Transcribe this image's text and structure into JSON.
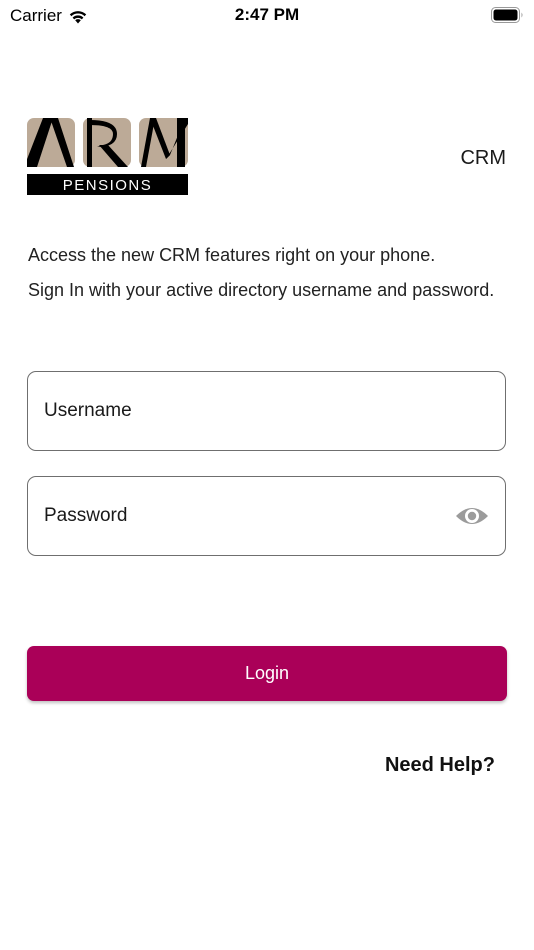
{
  "status_bar": {
    "carrier": "Carrier",
    "time": "2:47 PM"
  },
  "header": {
    "logo_letters": "ARM",
    "logo_subtitle": "PENSIONS",
    "title": "CRM"
  },
  "intro": {
    "line1": "Access the new CRM features right on your phone.",
    "line2": "Sign In with your active directory username and password."
  },
  "form": {
    "username_placeholder": "Username",
    "password_placeholder": "Password",
    "login_label": "Login"
  },
  "help": {
    "label": "Need Help?"
  },
  "colors": {
    "accent": "#aa0058",
    "logo_tile": "#bcaa97",
    "logo_band": "#000000"
  },
  "icons": {
    "wifi": "wifi-icon",
    "battery": "battery-icon",
    "password_visibility": "eye-icon"
  }
}
